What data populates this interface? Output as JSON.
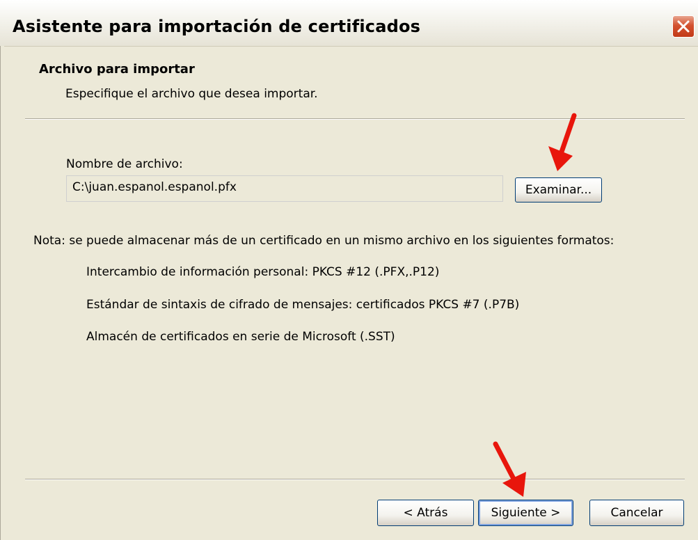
{
  "window": {
    "title": "Asistente para importación de certificados",
    "close_icon": "close-icon"
  },
  "header": {
    "title": "Archivo para importar",
    "subtitle": "Especifique el archivo que desea importar."
  },
  "file": {
    "label": "Nombre de archivo:",
    "value": "C:\\juan.espanol.espanol.pfx",
    "browse_label": "Examinar..."
  },
  "note": {
    "text": "Nota: se puede almacenar más de un certificado en un mismo archivo en los siguientes formatos:",
    "formats": [
      "Intercambio de información personal: PKCS #12 (.PFX,.P12)",
      "Estándar de sintaxis de cifrado de mensajes: certificados PKCS #7 (.P7B)",
      "Almacén de certificados en serie de Microsoft (.SST)"
    ]
  },
  "buttons": {
    "back": "< Atrás",
    "next": "Siguiente >",
    "cancel": "Cancelar"
  },
  "annotations": {
    "arrow_color": "#e8160c",
    "arrow_icon": "red-arrow-icon"
  }
}
